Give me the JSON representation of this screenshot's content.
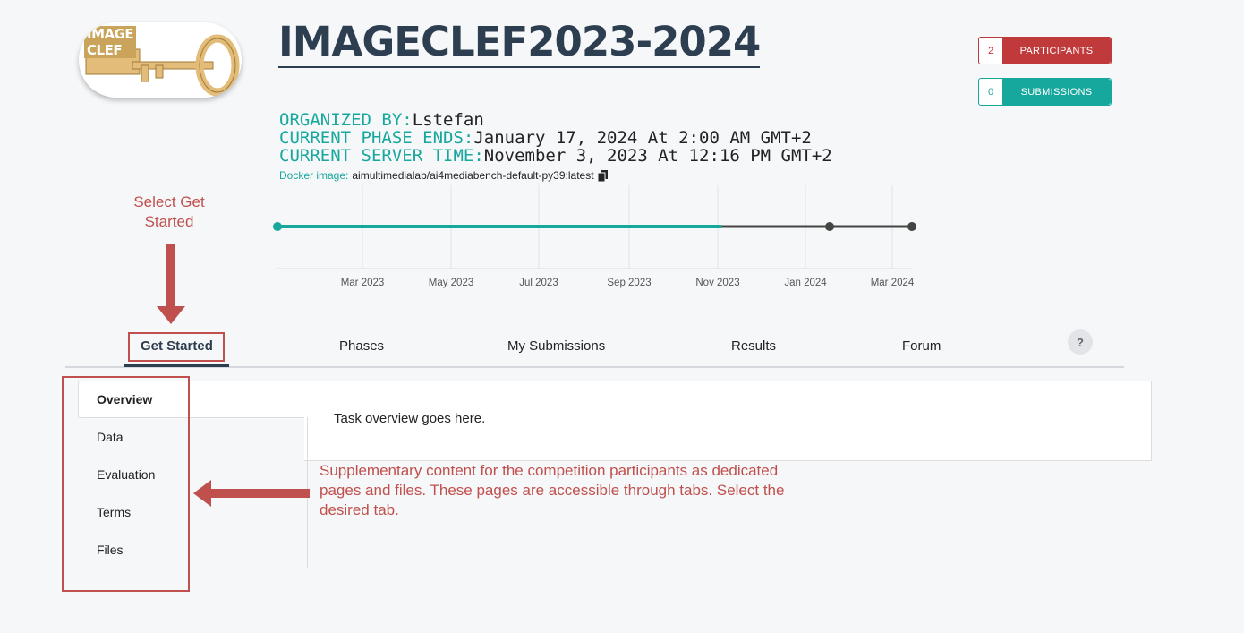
{
  "logo": {
    "line1": "IMAGE",
    "line2": "CLEF"
  },
  "title": "IMAGECLEF2023-2024",
  "stats": {
    "participants": {
      "count": "2",
      "label": "PARTICIPANTS",
      "color": "#c0393b"
    },
    "submissions": {
      "count": "0",
      "label": "SUBMISSIONS",
      "color": "#17a89d"
    }
  },
  "info": {
    "organized_label": "ORGANIZED BY:",
    "organized_value": "Lstefan",
    "phase_label": "CURRENT PHASE ENDS:",
    "phase_value": "January 17, 2024 At 2:00 AM GMT+2",
    "server_label": "CURRENT SERVER TIME:",
    "server_value": "November 3, 2023 At 12:16 PM GMT+2",
    "docker_label": "Docker image:",
    "docker_value": "aimultimedialab/ai4mediabench-default-py39:latest",
    "copy_icon": "copy-icon"
  },
  "timeline": {
    "ticks": [
      "Mar 2023",
      "May 2023",
      "Jul 2023",
      "Sep 2023",
      "Nov 2023",
      "Jan 2024",
      "Mar 2024"
    ],
    "progress_fraction": 0.7,
    "colors": {
      "done": "#17a89d",
      "remaining": "#444444"
    }
  },
  "tabs": [
    {
      "label": "Get Started",
      "active": true
    },
    {
      "label": "Phases"
    },
    {
      "label": "My Submissions"
    },
    {
      "label": "Results"
    },
    {
      "label": "Forum"
    }
  ],
  "help_label": "?",
  "side_nav": [
    "Overview",
    "Data",
    "Evaluation",
    "Terms",
    "Files"
  ],
  "content_text": "Task overview goes here.",
  "annotations": {
    "select_line1": "Select Get",
    "select_line2": "Started",
    "supp_line1": "Supplementary content for the competition participants as dedicated",
    "supp_line2": "pages and files. These pages are accessible through tabs. Select the",
    "supp_line3": "desired tab."
  }
}
